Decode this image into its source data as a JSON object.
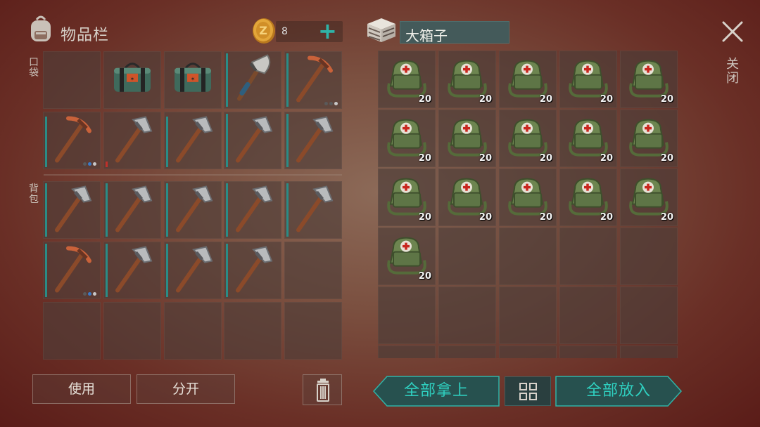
{
  "inventory": {
    "title": "物品栏",
    "coins": "8",
    "plus_label": "+",
    "pocket_label": "口袋",
    "backpack_label": "背包",
    "pocket_slots": [
      {
        "item": "empty"
      },
      {
        "item": "explosive-pack-icon"
      },
      {
        "item": "explosive-pack-icon"
      },
      {
        "item": "hatchet-icon",
        "durability": 1.0
      },
      {
        "item": "copper-pickaxe-icon",
        "durability": 1.0,
        "dots": [
          "gray",
          "gray",
          "white"
        ]
      },
      {
        "item": "copper-pickaxe-icon",
        "durability": 0.95,
        "dots": [
          "gray",
          "blue",
          "white"
        ]
      },
      {
        "item": "iron-pickaxe-icon",
        "durability": 0.1,
        "color": "#c0302a"
      },
      {
        "item": "iron-pickaxe-icon",
        "durability": 0.95
      },
      {
        "item": "iron-pickaxe-icon",
        "durability": 1.0
      },
      {
        "item": "iron-pickaxe-icon",
        "durability": 1.0
      }
    ],
    "backpack_slots": [
      {
        "item": "iron-pickaxe-icon",
        "durability": 1.0
      },
      {
        "item": "iron-pickaxe-icon",
        "durability": 1.0
      },
      {
        "item": "iron-pickaxe-icon",
        "durability": 1.0
      },
      {
        "item": "iron-pickaxe-icon",
        "durability": 1.0
      },
      {
        "item": "iron-pickaxe-icon",
        "durability": 1.0
      },
      {
        "item": "copper-pickaxe-icon",
        "durability": 1.0,
        "dots": [
          "gray",
          "blue",
          "white"
        ]
      },
      {
        "item": "iron-pickaxe-icon",
        "durability": 1.0
      },
      {
        "item": "iron-pickaxe-icon",
        "durability": 1.0
      },
      {
        "item": "iron-pickaxe-icon",
        "durability": 1.0
      },
      {
        "item": "empty"
      },
      {
        "item": "empty"
      },
      {
        "item": "empty"
      },
      {
        "item": "empty"
      },
      {
        "item": "empty"
      },
      {
        "item": "empty"
      }
    ],
    "use_label": "使用",
    "split_label": "分开"
  },
  "storage": {
    "title": "大箱子",
    "close_label": "关闭",
    "item_name": "first-aid-bag-icon",
    "item_qty": "20",
    "filled_count": 16,
    "take_all_label": "全部拿上",
    "put_all_label": "全部放入"
  },
  "colors": {
    "accent": "#2fd0c0",
    "durability": "#2a8c86",
    "durability_low": "#c0302a"
  }
}
